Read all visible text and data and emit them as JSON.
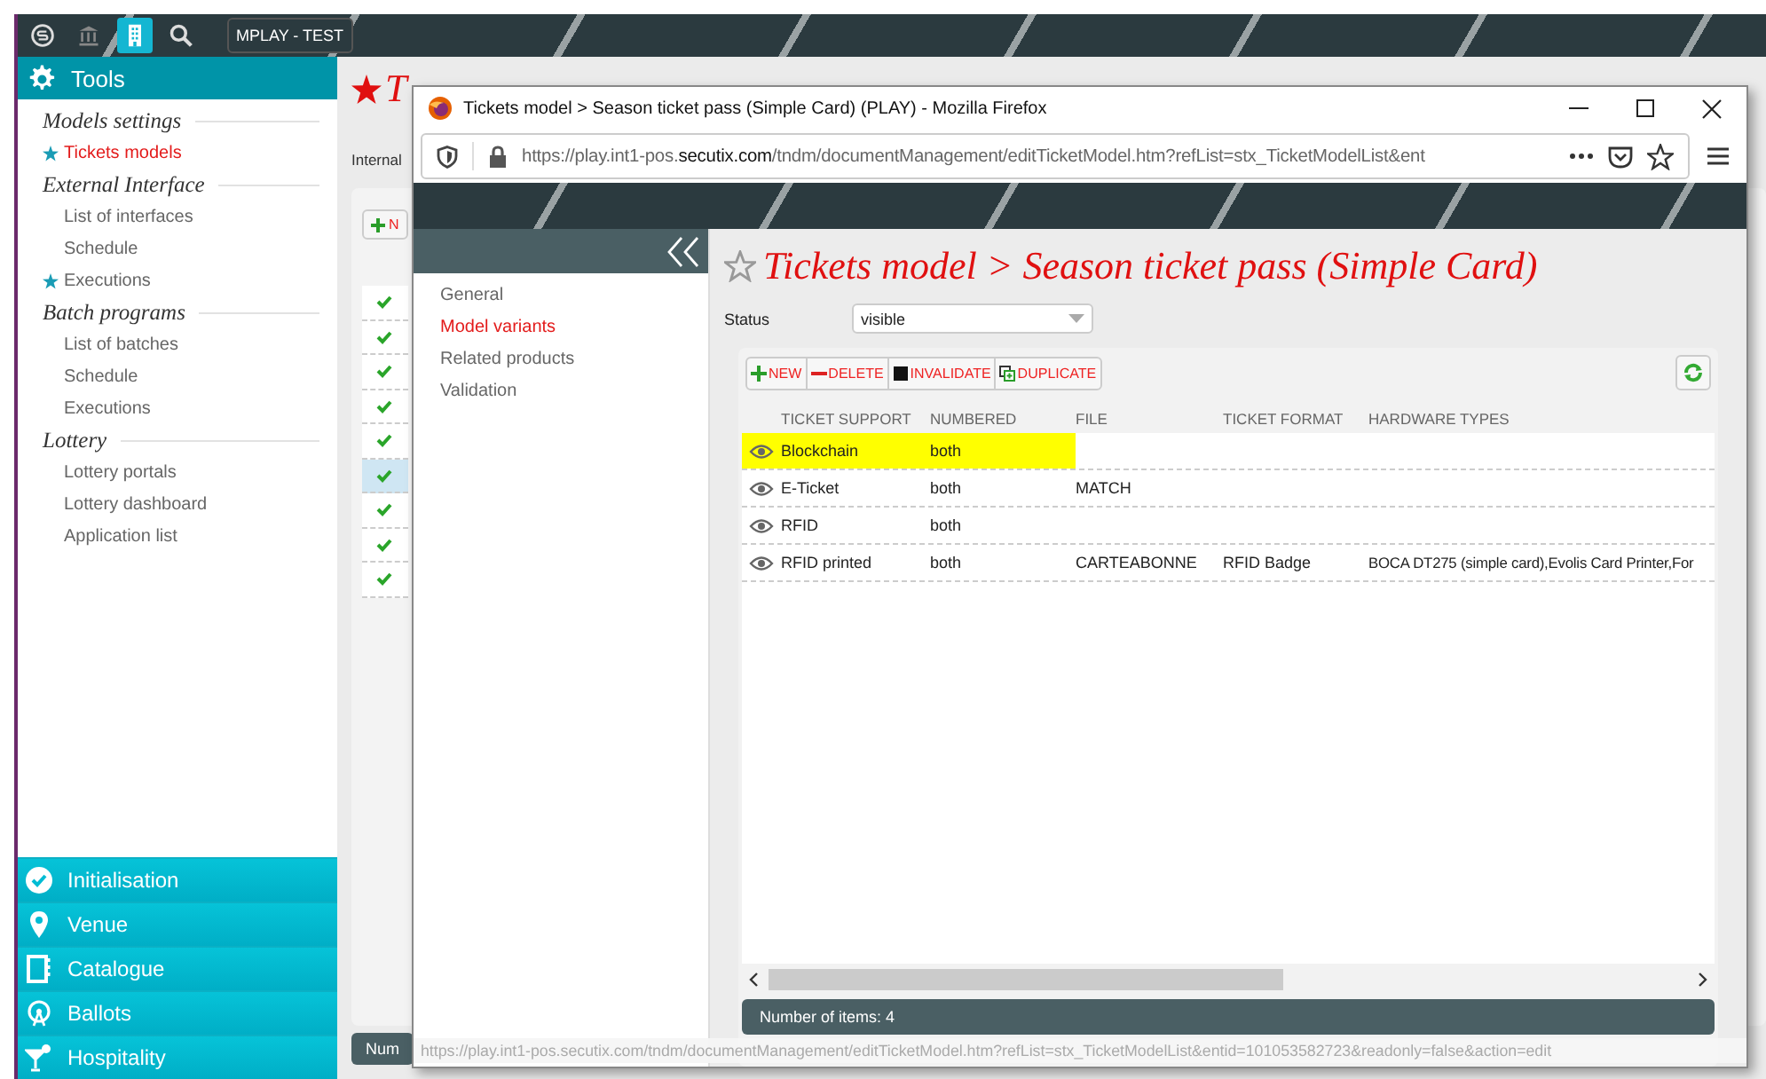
{
  "top_bar": {
    "icons": [
      {
        "kind": "logo",
        "selected": false
      },
      {
        "kind": "bank",
        "selected": false
      },
      {
        "kind": "building",
        "selected": true
      },
      {
        "kind": "search",
        "selected": false
      }
    ],
    "environment_badge": "MPLAY - TEST"
  },
  "sidebar": {
    "header": "Tools",
    "sections": [
      {
        "title": "Models settings",
        "items": [
          {
            "label": "Tickets models",
            "starred": true,
            "selected": true
          }
        ]
      },
      {
        "title": "External Interface",
        "items": [
          {
            "label": "List of interfaces",
            "starred": false,
            "selected": false
          },
          {
            "label": "Schedule",
            "starred": false,
            "selected": false
          },
          {
            "label": "Executions",
            "starred": true,
            "selected": false
          }
        ]
      },
      {
        "title": "Batch programs",
        "items": [
          {
            "label": "List of batches",
            "starred": false,
            "selected": false
          },
          {
            "label": "Schedule",
            "starred": false,
            "selected": false
          },
          {
            "label": "Executions",
            "starred": false,
            "selected": false
          }
        ]
      },
      {
        "title": "Lottery",
        "items": [
          {
            "label": "Lottery portals",
            "starred": false,
            "selected": false
          },
          {
            "label": "Lottery dashboard",
            "starred": false,
            "selected": false
          },
          {
            "label": "Application list",
            "starred": false,
            "selected": false
          }
        ]
      }
    ],
    "modules": [
      {
        "label": "Initialisation",
        "kind": "check"
      },
      {
        "label": "Venue",
        "kind": "pin"
      },
      {
        "label": "Catalogue",
        "kind": "book"
      },
      {
        "label": "Ballots",
        "kind": "wheel"
      },
      {
        "label": "Hospitality",
        "kind": "cocktail"
      }
    ]
  },
  "background_page": {
    "title": "T",
    "filter_label": "Internal",
    "new_button": "N",
    "rows": [
      {
        "selected": false
      },
      {
        "selected": false
      },
      {
        "selected": false
      },
      {
        "selected": false
      },
      {
        "selected": false
      },
      {
        "selected": true
      },
      {
        "selected": false
      },
      {
        "selected": false
      },
      {
        "selected": false
      }
    ],
    "footer": "Num"
  },
  "popup": {
    "window_title": "Tickets model > Season ticket pass (Simple Card) (PLAY) - Mozilla Firefox",
    "url": {
      "start": "https://play.int1-pos.",
      "domain": "secutix.com",
      "path": "/tndm/documentManagement/editTicketModel.htm?refList=stx_TicketModelList&ent"
    },
    "nav": [
      {
        "label": "General",
        "selected": false
      },
      {
        "label": "Model variants",
        "selected": true
      },
      {
        "label": "Related products",
        "selected": false
      },
      {
        "label": "Validation",
        "selected": false
      }
    ],
    "page_title": "Tickets model > Season ticket pass (Simple Card)",
    "status": {
      "label": "Status",
      "value": "visible"
    },
    "toolbar": [
      {
        "label": "NEW",
        "kind": "new"
      },
      {
        "label": "DELETE",
        "kind": "delete"
      },
      {
        "label": "INVALIDATE",
        "kind": "invalidate"
      },
      {
        "label": "DUPLICATE",
        "kind": "duplicate"
      }
    ],
    "table": {
      "columns": [
        "TICKET SUPPORT",
        "NUMBERED",
        "FILE",
        "TICKET FORMAT",
        "HARDWARE TYPES"
      ],
      "rows": [
        {
          "ticket_support": "Blockchain",
          "numbered": "both",
          "selected": true
        },
        {
          "ticket_support": "E-Ticket",
          "numbered": "both",
          "file": "MATCH",
          "selected": false
        },
        {
          "ticket_support": "RFID",
          "numbered": "both",
          "selected": false
        },
        {
          "ticket_support": "RFID printed",
          "numbered": "both",
          "file": "CARTEABONNE",
          "ticket_format": "RFID Badge",
          "hardware_types": "BOCA DT275 (simple card),Evolis Card Printer,For",
          "selected": false
        }
      ]
    },
    "footer": "Number of items: 4",
    "status_url": "https://play.int1-pos.secutix.com/tndm/documentManagement/editTicketModel.htm?refList=stx_TicketModelList&entid=101053582723&readonly=false&action=edit"
  }
}
